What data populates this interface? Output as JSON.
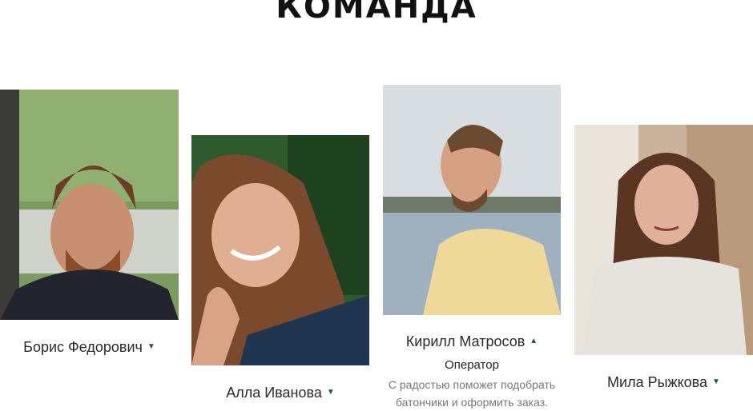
{
  "section": {
    "title": "КОМАНДА"
  },
  "members": [
    {
      "name": "Борис Федорович",
      "arrow": "▼",
      "photo_icon": "portrait-photo"
    },
    {
      "name": "Алла Иванова",
      "arrow": "▼",
      "photo_icon": "portrait-photo"
    },
    {
      "name": "Кирилл Матросов",
      "arrow": "▲",
      "photo_icon": "portrait-photo",
      "role": "Оператор",
      "description_line1": "С радостью поможет подобрать",
      "description_line2": "батончики и оформить заказ."
    },
    {
      "name": "Мила Рыжкова",
      "arrow": "▼",
      "photo_icon": "portrait-photo"
    }
  ],
  "colors": {
    "accent": "#1f5a3a",
    "text": "#2a2a2a",
    "muted": "#777777"
  }
}
